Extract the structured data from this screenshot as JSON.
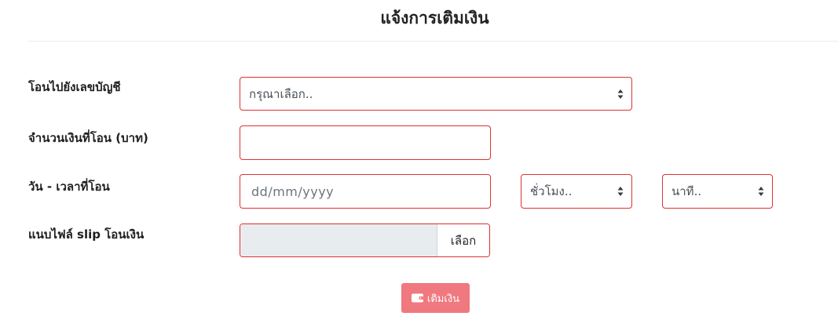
{
  "page": {
    "title": "แจ้งการเติมเงิน"
  },
  "form": {
    "account": {
      "label": "โอนไปยังเลขบัญชี",
      "selected": "กรุณาเลือก.."
    },
    "amount": {
      "label": "จำนวนเงินที่โอน (บาท)",
      "value": ""
    },
    "datetime": {
      "label": "วัน - เวลาที่โอน",
      "date_placeholder": "dd/mm/yyyy",
      "hour_selected": "ชั่วโมง..",
      "minute_selected": "นาที.."
    },
    "slip": {
      "label": "แนบไฟล์ slip โอนเงิน",
      "browse_label": "เลือก"
    },
    "submit": {
      "label": "เติมเงิน",
      "icon": "wallet-icon"
    }
  },
  "colors": {
    "invalid_border": "#e03131",
    "submit_bg": "#f0787f",
    "file_input_bg": "#e9ecef"
  }
}
